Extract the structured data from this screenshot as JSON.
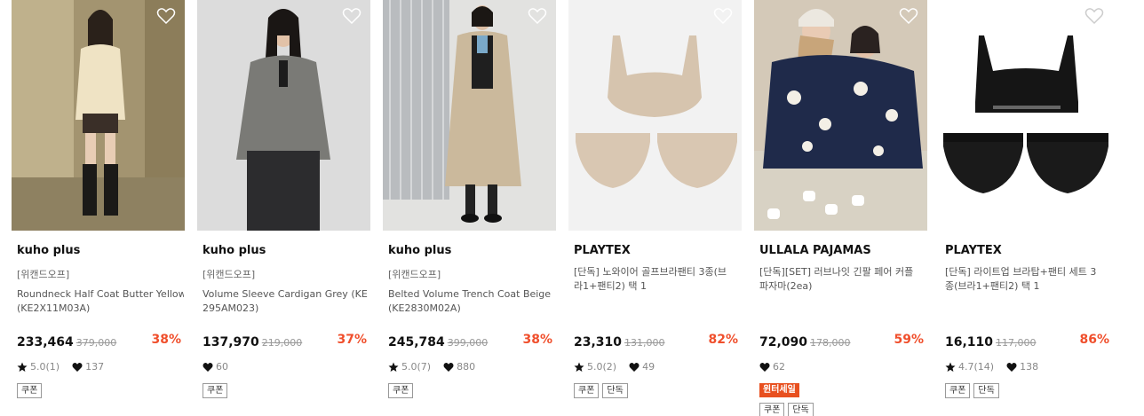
{
  "products": [
    {
      "brand": "kuho plus",
      "tagline": "[위캔드오프]",
      "name_lines": [
        "Roundneck Half Coat Butter Yellow",
        "(KE2X11M03A)"
      ],
      "price": "233,464",
      "original_price": "379,000",
      "discount": "38%",
      "rating": "5.0(1)",
      "likes": "137",
      "promo": null,
      "tags": [
        "쿠폰"
      ]
    },
    {
      "brand": "kuho plus",
      "tagline": "[위캔드오프]",
      "name_lines": [
        "Volume Sleeve Cardigan Grey (KE",
        "295AM023)"
      ],
      "price": "137,970",
      "original_price": "219,000",
      "discount": "37%",
      "rating": null,
      "likes": "60",
      "promo": null,
      "tags": [
        "쿠폰"
      ]
    },
    {
      "brand": "kuho plus",
      "tagline": "[위캔드오프]",
      "name_lines": [
        "Belted Volume Trench Coat Beige",
        "(KE2830M02A)"
      ],
      "price": "245,784",
      "original_price": "399,000",
      "discount": "38%",
      "rating": "5.0(7)",
      "likes": "880",
      "promo": null,
      "tags": [
        "쿠폰"
      ]
    },
    {
      "brand": "PLAYTEX",
      "tagline": null,
      "name_lines": [
        "[단독] 노와이어 골프브라팬티 3종(브",
        "라1+팬티2) 택 1"
      ],
      "price": "23,310",
      "original_price": "131,000",
      "discount": "82%",
      "rating": "5.0(2)",
      "likes": "49",
      "promo": null,
      "tags": [
        "쿠폰",
        "단독"
      ]
    },
    {
      "brand": "ULLALA PAJAMAS",
      "tagline": null,
      "name_lines": [
        "[단독][SET] 러브나잇 긴팔 페어 커플",
        "파자마(2ea)"
      ],
      "price": "72,090",
      "original_price": "178,000",
      "discount": "59%",
      "rating": null,
      "likes": "62",
      "promo": "윈터세일",
      "tags": [
        "쿠폰",
        "단독"
      ]
    },
    {
      "brand": "PLAYTEX",
      "tagline": null,
      "name_lines": [
        "[단독] 라이트업 브라탑+팬티 세트 3",
        "종(브라1+팬티2) 택 1"
      ],
      "price": "16,110",
      "original_price": "117,000",
      "discount": "86%",
      "rating": "4.7(14)",
      "likes": "138",
      "promo": null,
      "tags": [
        "쿠폰",
        "단독"
      ]
    }
  ],
  "colors": {
    "discount": "#f04f2c",
    "promo_badge": "#e8501f",
    "price": "#111111",
    "muted": "#888888"
  },
  "icons": {
    "wishlist": "heart-outline-icon",
    "rating": "star-icon",
    "likes": "heart-filled-icon"
  }
}
